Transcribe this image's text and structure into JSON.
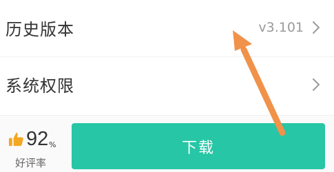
{
  "rows": [
    {
      "label": "历史版本",
      "value": "v3.101"
    },
    {
      "label": "系统权限",
      "value": ""
    }
  ],
  "rating": {
    "value": "92",
    "unit": "%",
    "caption": "好评率"
  },
  "download": {
    "label": "下载"
  },
  "colors": {
    "accent": "#26c6a6",
    "thumb": "#f5a623",
    "annotation_arrow": "#f0924a"
  },
  "icons": {
    "chevron": "chevron-right-icon",
    "thumb": "thumbs-up-icon",
    "arrow": "annotation-arrow-icon"
  }
}
